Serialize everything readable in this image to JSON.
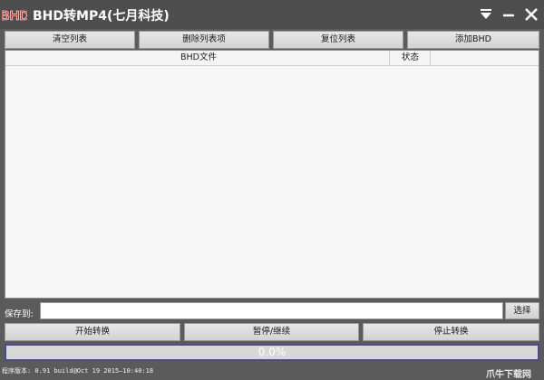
{
  "window": {
    "title": "BHD转MP4(七月科技)",
    "logo_text": "BHD",
    "colors": {
      "logo": "#d42a1e",
      "background": "#5b5b5b",
      "titlebar": "#4e4e4e"
    },
    "controls": {
      "menu_icon": "dropdown-arrow-icon",
      "minimize_icon": "minimize-icon",
      "close_icon": "close-icon"
    }
  },
  "toolbar": {
    "clear_list": "清空列表",
    "delete_items": "删除列表项",
    "reset_list": "复位列表",
    "add_bhd": "添加BHD"
  },
  "file_list": {
    "columns": {
      "file": "BHD文件",
      "status": "状态",
      "extra": ""
    },
    "rows": []
  },
  "save": {
    "label": "保存到:",
    "path": "",
    "browse": "选择"
  },
  "actions": {
    "start": "开始转换",
    "pause_resume": "暂停/继续",
    "stop": "停止转换"
  },
  "progress": {
    "value": 0,
    "text": "0.0%"
  },
  "status_bar": {
    "version": "程序版本: 0.91  build@Oct 19 2015—10:40:18"
  },
  "watermark": "爪牛下载网"
}
